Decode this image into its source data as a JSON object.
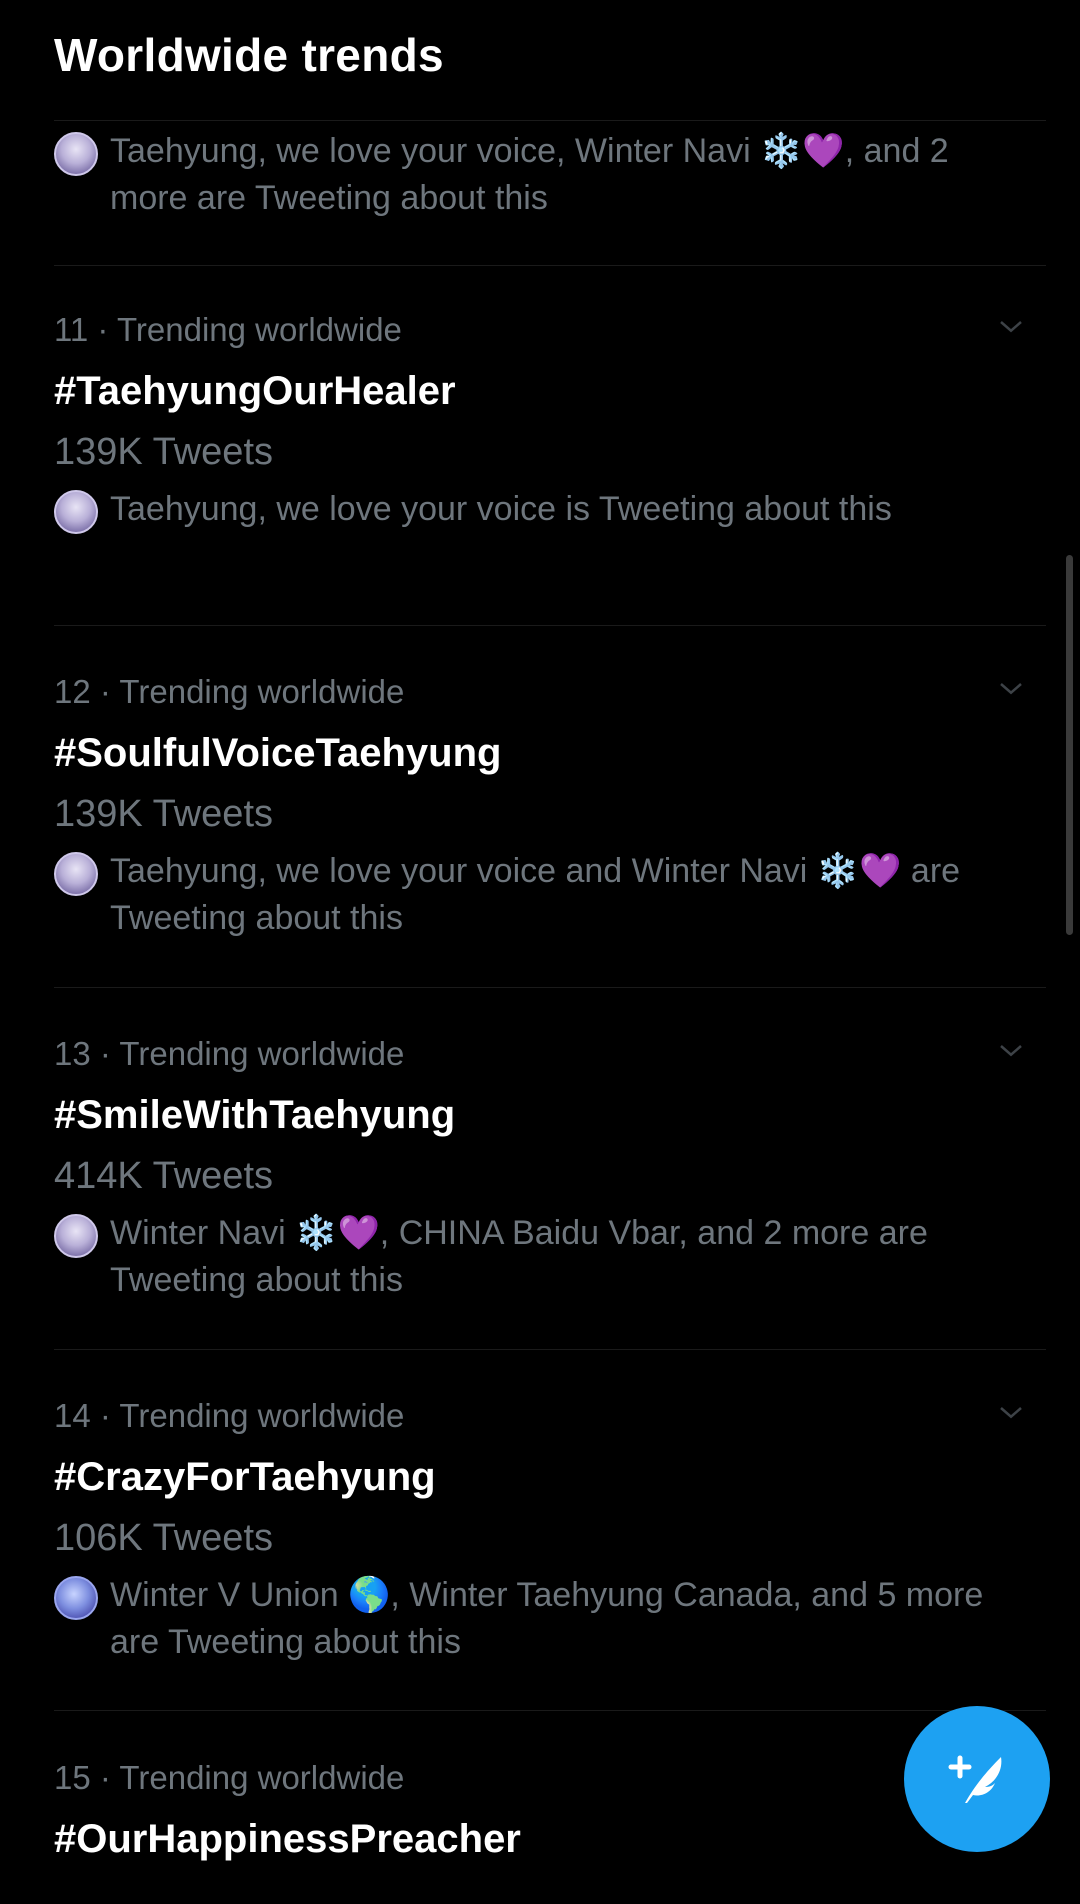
{
  "header": {
    "title": "Worldwide trends"
  },
  "top_partial": {
    "social_text": "Taehyung, we love your voice, Winter Navi ❄️💜, and 2 more are Tweeting about this"
  },
  "trends": [
    {
      "meta": "11 · Trending worldwide",
      "hashtag": "#TaehyungOurHealer",
      "count": "139K Tweets",
      "social_text": "Taehyung, we love your voice is Tweeting about this"
    },
    {
      "meta": "12 · Trending worldwide",
      "hashtag": "#SoulfulVoiceTaehyung",
      "count": "139K Tweets",
      "social_text": "Taehyung, we love your voice and Winter Navi ❄️💜 are Tweeting about this"
    },
    {
      "meta": "13 · Trending worldwide",
      "hashtag": "#SmileWithTaehyung",
      "count": "414K Tweets",
      "social_text": "Winter Navi ❄️💜, CHINA Baidu Vbar, and 2 more are Tweeting about this"
    },
    {
      "meta": "14 · Trending worldwide",
      "hashtag": "#CrazyForTaehyung",
      "count": "106K Tweets",
      "social_text": "Winter V Union 🌎, Winter Taehyung Canada, and 5 more are Tweeting about this"
    },
    {
      "meta": "15 · Trending worldwide",
      "hashtag": "#OurHappinessPreacher"
    }
  ],
  "icons": {
    "trend_menu": "chevron-down-icon",
    "compose": "compose-tweet-icon"
  },
  "colors": {
    "background": "#000000",
    "primary_text": "#ffffff",
    "secondary_text": "#6e767d",
    "accent": "#1da1f2"
  }
}
